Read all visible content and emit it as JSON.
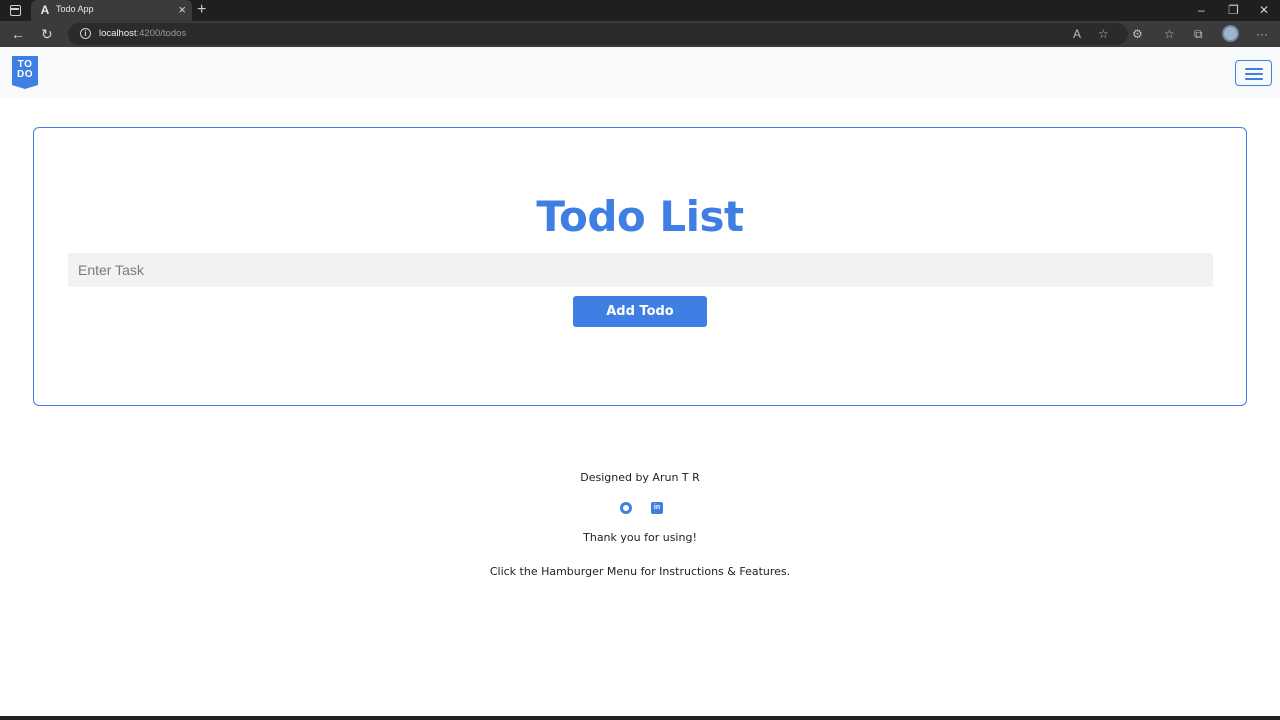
{
  "browser": {
    "tab_title": "Todo App",
    "tab_favicon": "A",
    "tab_close": "×",
    "new_tab": "+",
    "url_host": "localhost",
    "url_path": ":4200/todos",
    "window_controls": [
      "–",
      "❐",
      "✕"
    ]
  },
  "navbar": {
    "logo_line1": "TO",
    "logo_line2": "DO"
  },
  "main": {
    "title": "Todo List",
    "task_placeholder": "Enter Task",
    "task_value": "",
    "add_button": "Add Todo"
  },
  "footer": {
    "designer": "Designed by Arun T R",
    "thanks": "Thank you for using!",
    "instructions": "Click the Hamburger Menu for Instructions & Features.",
    "linkedin_glyph": "in"
  },
  "colors": {
    "accent": "#3f7fe3",
    "navbar_bg": "#f8f9fa",
    "input_bg": "#f2f2f2"
  }
}
